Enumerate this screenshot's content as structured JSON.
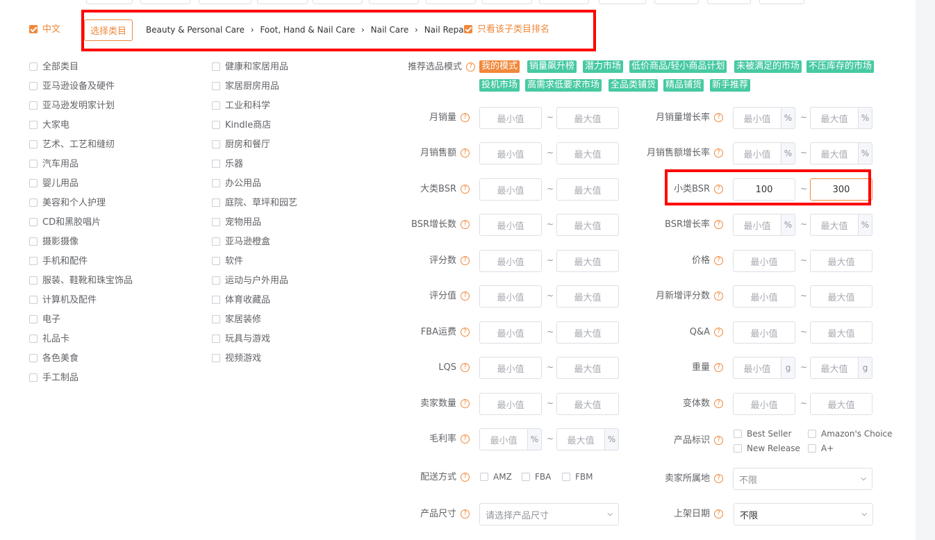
{
  "language": {
    "label": "中文",
    "checked": true
  },
  "category_bar": {
    "select_button": "选择类目",
    "breadcrumb": [
      "Beauty & Personal Care",
      "Foot, Hand & Nail Care",
      "Nail Care",
      "Nail Repair"
    ],
    "separator": "›",
    "only_sub_label": "只看该子类目排名",
    "only_sub_checked": true
  },
  "categories_col1": [
    "全部类目",
    "亚马逊设备及硬件",
    "亚马逊发明家计划",
    "大家电",
    "艺术、工艺和缝纫",
    "汽车用品",
    "婴儿用品",
    "美容和个人护理",
    "CD和黑胶唱片",
    "摄影摄像",
    "手机和配件",
    "服装、鞋靴和珠宝饰品",
    "计算机及配件",
    "电子",
    "礼品卡",
    "各色美食",
    "手工制品"
  ],
  "categories_col2": [
    "健康和家居用品",
    "家居厨房用品",
    "工业和科学",
    "Kindle商店",
    "厨房和餐厅",
    "乐器",
    "办公用品",
    "庭院、草坪和园艺",
    "宠物用品",
    "亚马逊橙盒",
    "软件",
    "运动与户外用品",
    "体育收藏品",
    "家居装修",
    "玩具与游戏",
    "视频游戏"
  ],
  "mode": {
    "label": "推荐选品模式",
    "tags": [
      {
        "text": "我的模式",
        "style": "orange"
      },
      {
        "text": "销量飙升榜",
        "style": "green"
      },
      {
        "text": "潜力市场",
        "style": "green"
      },
      {
        "text": "低价商品/轻小商品计划",
        "style": "green"
      },
      {
        "text": "未被满足的市场",
        "style": "green"
      },
      {
        "text": "不压库存的市场",
        "style": "green"
      },
      {
        "text": "投机市场",
        "style": "green"
      },
      {
        "text": "高需求低要求市场",
        "style": "green"
      },
      {
        "text": "全品类铺货",
        "style": "green"
      },
      {
        "text": "精品铺货",
        "style": "green"
      },
      {
        "text": "新手推荐",
        "style": "green"
      }
    ]
  },
  "placeholders": {
    "min": "最小值",
    "max": "最大值"
  },
  "tilde": "~",
  "filters_left": [
    {
      "label": "月销量"
    },
    {
      "label": "月销售额"
    },
    {
      "label": "大类BSR"
    },
    {
      "label": "BSR增长数"
    },
    {
      "label": "评分数"
    },
    {
      "label": "评分值"
    },
    {
      "label": "FBA运费"
    },
    {
      "label": "LQS"
    },
    {
      "label": "卖家数量"
    },
    {
      "label": "毛利率",
      "unit": "%"
    }
  ],
  "filters_right": [
    {
      "label": "月销量增长率",
      "unit": "%"
    },
    {
      "label": "月销售额增长率",
      "unit": "%"
    },
    {
      "label": "小类BSR",
      "min_value": "100",
      "max_value": "300"
    },
    {
      "label": "BSR增长率",
      "unit": "%"
    },
    {
      "label": "价格"
    },
    {
      "label": "月新增评分数"
    },
    {
      "label": "Q&A"
    },
    {
      "label": "重量",
      "unit": "g"
    },
    {
      "label": "变体数"
    }
  ],
  "product_badge": {
    "label": "产品标识",
    "options": [
      "Best Seller",
      "Amazon's Choice",
      "New Release",
      "A+"
    ]
  },
  "delivery": {
    "label": "配送方式",
    "options": [
      "AMZ",
      "FBA",
      "FBM"
    ]
  },
  "seller_location": {
    "label": "卖家所属地",
    "value": "不限"
  },
  "product_size": {
    "label": "产品尺寸",
    "placeholder": "请选择产品尺寸"
  },
  "listing_date": {
    "label": "上架日期",
    "value": "不限"
  },
  "help_glyph": "?",
  "colors": {
    "accent": "#f0883a",
    "tag_green": "#47c9a2",
    "highlight_red": "#ff0000"
  }
}
